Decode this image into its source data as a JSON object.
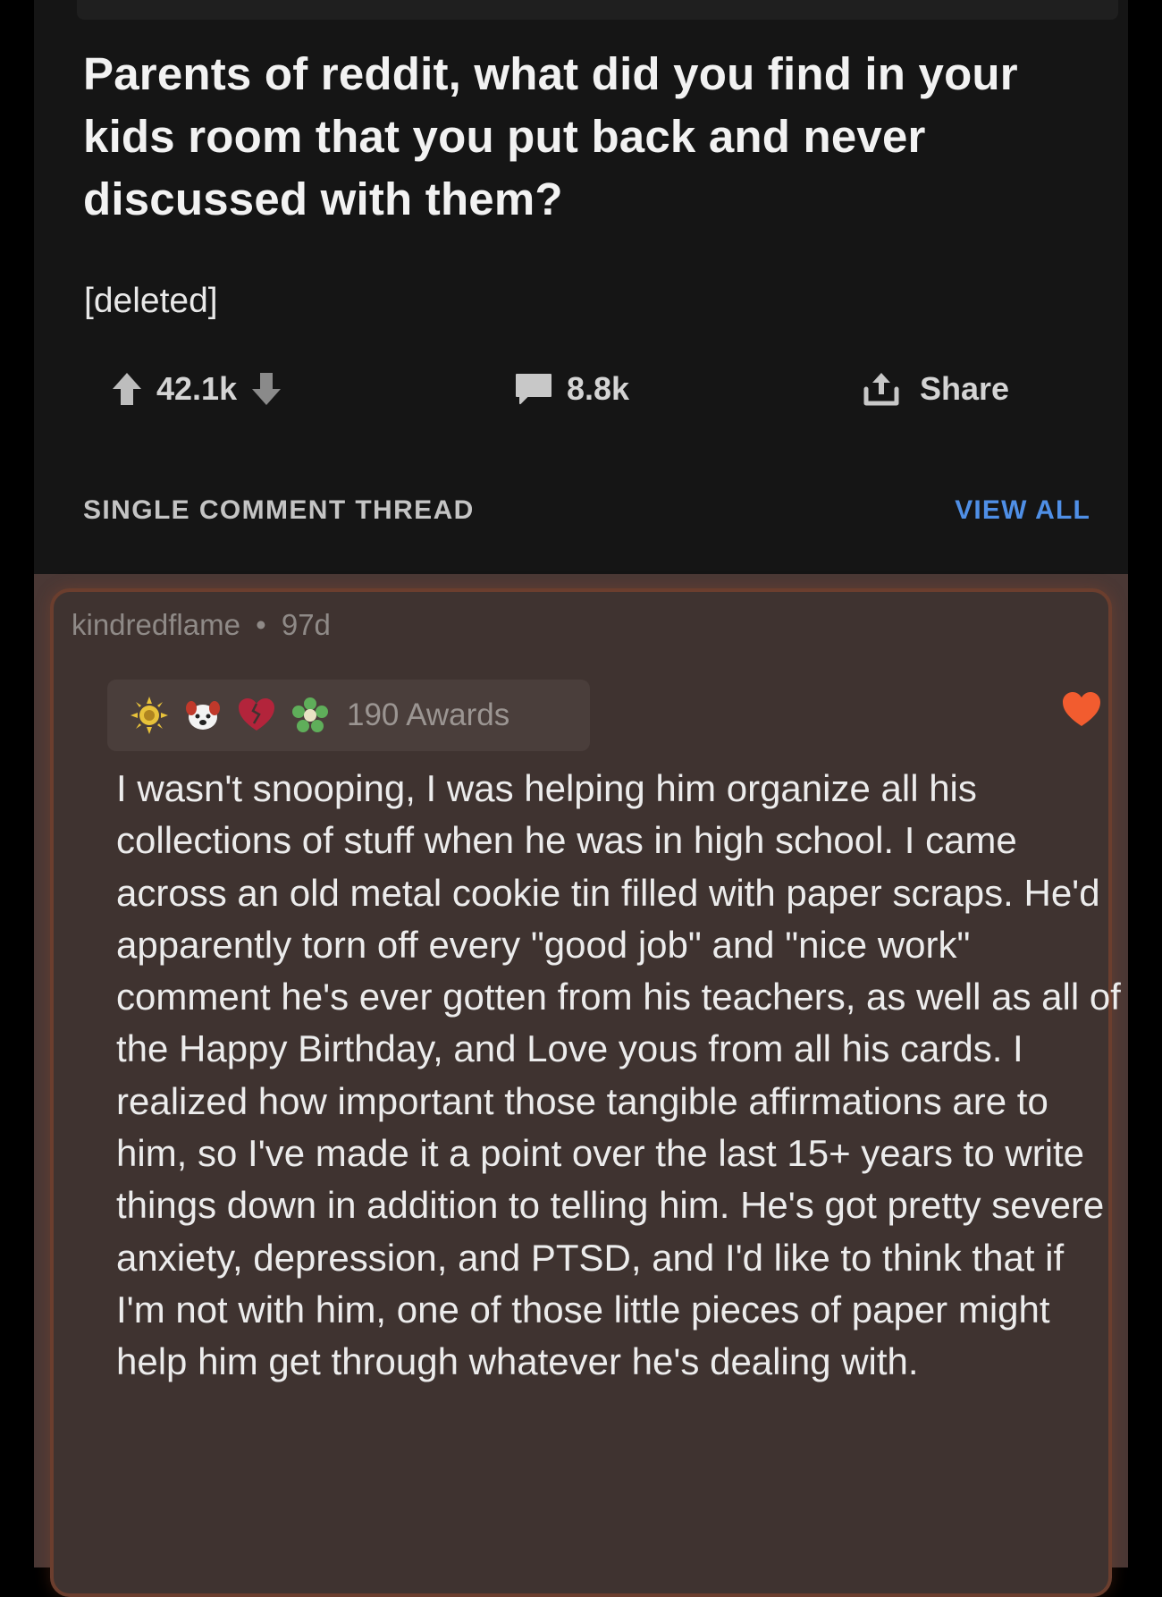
{
  "post": {
    "title": "Parents of reddit, what did you find in your kids room that you put back and never discussed with them?",
    "author": "[deleted]",
    "upvotes": "42.1k",
    "comments": "8.8k",
    "share_label": "Share",
    "icons": {
      "upvote": "arrow-up-icon",
      "downvote": "arrow-down-icon",
      "comments": "comment-bubble-icon",
      "share": "share-icon"
    }
  },
  "thread_bar": {
    "label": "SINGLE COMMENT THREAD",
    "view_all": "VIEW ALL"
  },
  "comment": {
    "username": "kindredflame",
    "separator": "•",
    "age": "97d",
    "awards_label": "190 Awards",
    "award_icons": [
      "sun-award-icon",
      "dog-award-icon",
      "broken-heart-award-icon",
      "wholesome-award-icon"
    ],
    "reaction_icon": "heart-icon",
    "body": "I wasn't snooping, I was helping him organize all his collections of stuff when he was in high school. I came across an old metal cookie tin filled with paper scraps. He'd apparently torn off every \"good job\" and \"nice work\" comment he's ever gotten from his teachers, as well as all of the Happy Birthday, and Love yous from all his cards. I realized how important those tangible affirmations are to him, so I've made it a point over the last 15+ years to write things down in addition to telling him. He's got pretty severe anxiety, depression, and PTSD, and I'd like to think that if I'm not with him, one of those little pieces of paper might help him get through whatever he's dealing with."
  },
  "colors": {
    "background": "#141414",
    "comment_background": "#3f3330",
    "comment_border": "#6b3e2e",
    "link_blue": "#4f8fe6",
    "heart_orange": "#f25c2f"
  }
}
